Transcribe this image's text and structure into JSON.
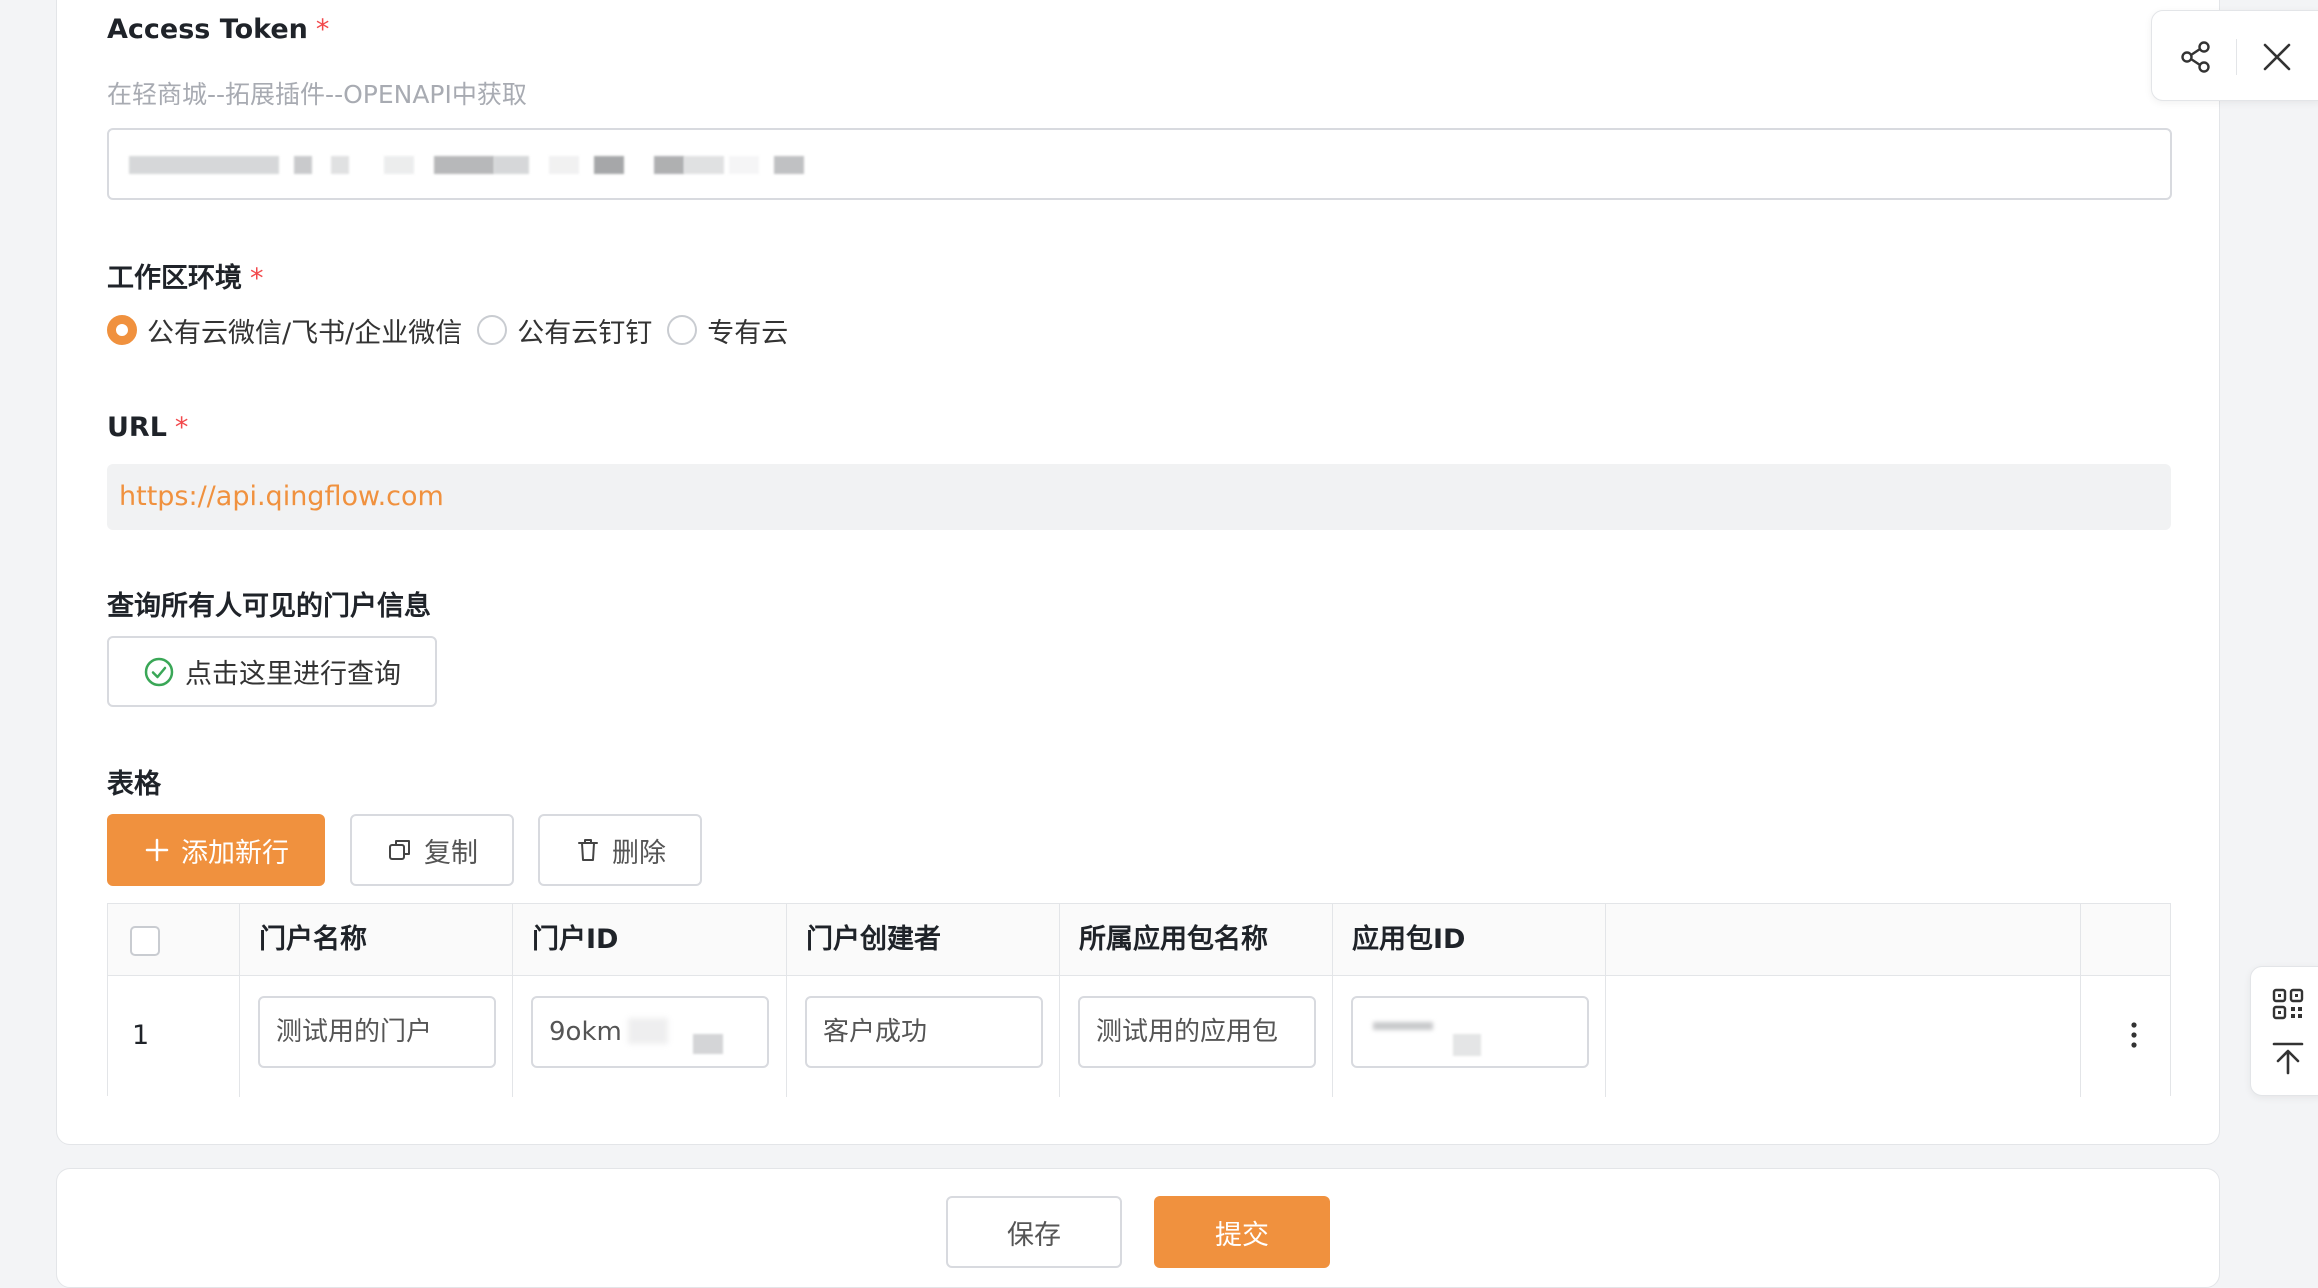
{
  "form": {
    "access_token": {
      "label": "Access Token",
      "required_mark": "*",
      "hint": "在轻商城--拓展插件--OPENAPI中获取"
    },
    "workspace_env": {
      "label": "工作区环境",
      "required_mark": "*",
      "options": [
        "公有云微信/飞书/企业微信",
        "公有云钉钉",
        "专有云"
      ],
      "selected": "公有云微信/飞书/企业微信"
    },
    "url": {
      "label": "URL",
      "required_mark": "*",
      "value": "https://api.qingflow.com"
    },
    "portal_query": {
      "label": "查询所有人可见的门户信息",
      "button_label": "点击这里进行查询"
    },
    "table": {
      "label": "表格",
      "add_row_label": "添加新行",
      "copy_label": "复制",
      "delete_label": "删除",
      "columns": [
        "门户名称",
        "门户ID",
        "门户创建者",
        "所属应用包名称",
        "应用包ID"
      ],
      "rows": [
        {
          "index": "1",
          "portal_name": "测试用的门户",
          "portal_id": "9okm",
          "creator": "客户成功",
          "package_name": "测试用的应用包",
          "package_id": ""
        }
      ]
    }
  },
  "footer": {
    "save_label": "保存",
    "submit_label": "提交"
  },
  "colors": {
    "accent": "#f0913e",
    "required": "#f2494c"
  },
  "icons": [
    "share-icon",
    "close-icon",
    "check-circle-icon",
    "plus-icon",
    "copy-icon",
    "trash-icon",
    "more-vertical-icon",
    "qr-code-icon",
    "back-to-top-icon"
  ]
}
